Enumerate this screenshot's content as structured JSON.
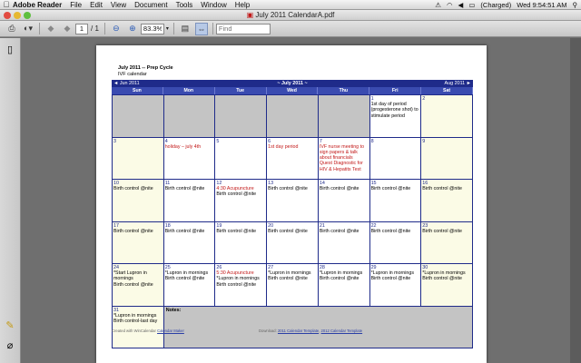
{
  "menubar": {
    "app": "Adobe Reader",
    "items": [
      "File",
      "Edit",
      "View",
      "Document",
      "Tools",
      "Window",
      "Help"
    ],
    "battery": "(Charged)",
    "clock": "Wed 9:54:51 AM"
  },
  "window": {
    "title": "July 2011 CalendarA.pdf"
  },
  "toolbar": {
    "page_current": "1",
    "page_total": "/ 1",
    "zoom": "83.3%",
    "find_placeholder": "Find"
  },
  "calendar": {
    "title": "July 2011 -- Prep Cycle",
    "subtitle": "IVF calendar",
    "prev_month": "◄ Jun 2011",
    "month": "~ July 2011 ~",
    "next_month": "Aug 2011 ►",
    "weekdays": [
      "Sun",
      "Mon",
      "Tue",
      "Wed",
      "Thu",
      "Fri",
      "Sat"
    ],
    "weeks": [
      [
        {
          "gray": true
        },
        {
          "gray": true
        },
        {
          "gray": true
        },
        {
          "gray": true
        },
        {
          "gray": true
        },
        {
          "day": "1",
          "events": [
            {
              "t": "1st day of period (progesterone shot) to stimulate period"
            }
          ]
        },
        {
          "day": "2",
          "we": true
        }
      ],
      [
        {
          "day": "3",
          "we": true
        },
        {
          "day": "4",
          "events": [
            {
              "t": "holiday – july 4th",
              "c": "red"
            }
          ]
        },
        {
          "day": "5"
        },
        {
          "day": "6",
          "events": [
            {
              "t": "1st day period",
              "c": "red"
            }
          ]
        },
        {
          "day": "7",
          "events": [
            {
              "t": "IVF nurse meeting to sign papers & talk about financials",
              "c": "red"
            },
            {
              "t": " "
            },
            {
              "t": "Quest Diagnostic for HIV & Hepatits Test",
              "c": "red"
            }
          ]
        },
        {
          "day": "8"
        },
        {
          "day": "9",
          "we": true
        }
      ],
      [
        {
          "day": "10",
          "we": true,
          "events": [
            {
              "t": "Birth control @nite"
            }
          ]
        },
        {
          "day": "11",
          "events": [
            {
              "t": "Birth control @nite"
            }
          ]
        },
        {
          "day": "12",
          "events": [
            {
              "t": "4:30 Acupuncture",
              "c": "red"
            },
            {
              "t": "Birth control @nite"
            }
          ]
        },
        {
          "day": "13",
          "events": [
            {
              "t": "Birth control @nite"
            }
          ]
        },
        {
          "day": "14",
          "events": [
            {
              "t": "Birth control @nite"
            }
          ]
        },
        {
          "day": "15",
          "events": [
            {
              "t": "Birth control @nite"
            }
          ]
        },
        {
          "day": "16",
          "we": true,
          "events": [
            {
              "t": "Birth control @nite"
            }
          ]
        }
      ],
      [
        {
          "day": "17",
          "we": true,
          "events": [
            {
              "t": "Birth control @nite"
            }
          ]
        },
        {
          "day": "18",
          "events": [
            {
              "t": "Birth control @nite"
            }
          ]
        },
        {
          "day": "19",
          "events": [
            {
              "t": "Birth control @nite"
            }
          ]
        },
        {
          "day": "20",
          "events": [
            {
              "t": "Birth control @nite"
            }
          ]
        },
        {
          "day": "21",
          "events": [
            {
              "t": "Birth control @nite"
            }
          ]
        },
        {
          "day": "22",
          "events": [
            {
              "t": "Birth control @nite"
            }
          ]
        },
        {
          "day": "23",
          "we": true,
          "events": [
            {
              "t": "Birth control @nite"
            }
          ]
        }
      ],
      [
        {
          "day": "24",
          "we": true,
          "events": [
            {
              "t": "*Start Lupron in mornings"
            },
            {
              "t": "Birth control @nite"
            }
          ]
        },
        {
          "day": "25",
          "events": [
            {
              "t": "*Lupron in mornings"
            },
            {
              "t": "Birth control @nite"
            }
          ]
        },
        {
          "day": "26",
          "events": [
            {
              "t": "5:30 Acupuncture",
              "c": "red"
            },
            {
              "t": "*Lupron in mornings"
            },
            {
              "t": "Birth control @nite"
            }
          ]
        },
        {
          "day": "27",
          "events": [
            {
              "t": "*Lupron in mornings"
            },
            {
              "t": "Birth control @nite"
            }
          ]
        },
        {
          "day": "28",
          "events": [
            {
              "t": "*Lupron in mornings"
            },
            {
              "t": "Birth control @nite"
            }
          ]
        },
        {
          "day": "29",
          "events": [
            {
              "t": "*Lupron in mornings"
            },
            {
              "t": "Birth control @nite"
            }
          ]
        },
        {
          "day": "30",
          "we": true,
          "events": [
            {
              "t": "*Lupron in mornings"
            },
            {
              "t": "Birth control @nite"
            }
          ]
        }
      ]
    ],
    "last_day": {
      "day": "31",
      "events": [
        {
          "t": "*Lupron in mornings"
        },
        {
          "t": "Birth control-last day"
        }
      ]
    },
    "notes_label": "Notes:",
    "footer_left": "Created with WinCalendar",
    "footer_left_link": "Calendar Maker",
    "footer_right": "Download:",
    "footer_right_link1": "2011 Calendar Template",
    "footer_right_link2": "2012 Calendar Template"
  }
}
